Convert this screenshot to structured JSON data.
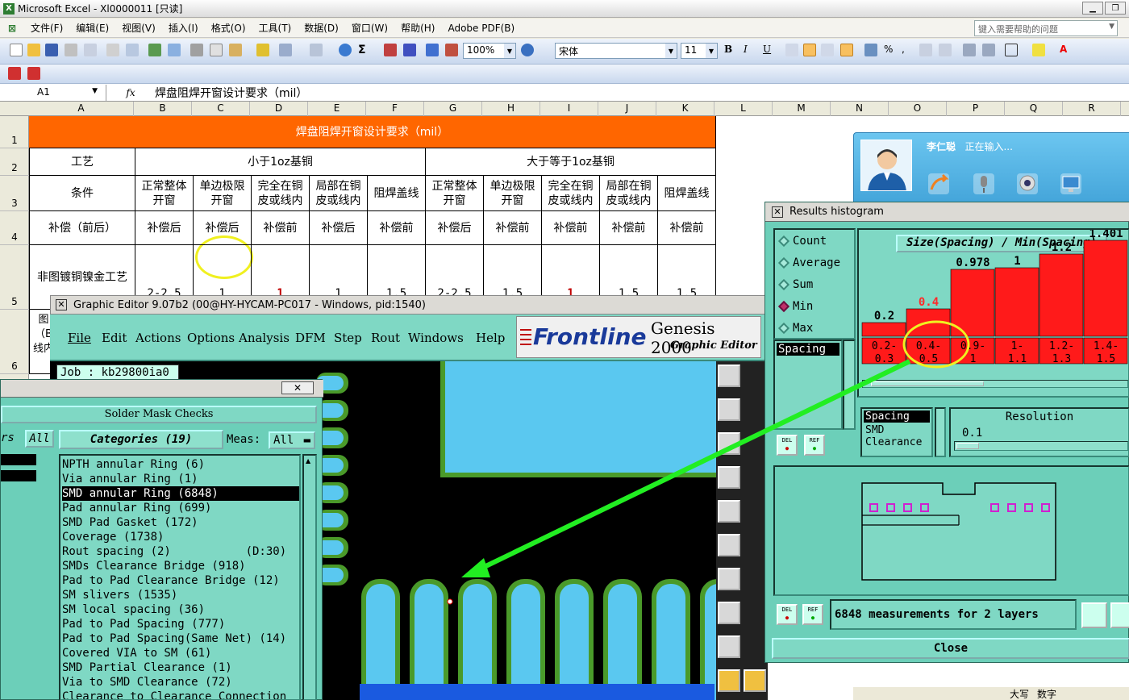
{
  "excel": {
    "title": "Microsoft Excel - Xl0000011  [只读]",
    "menu": [
      "文件(F)",
      "编辑(E)",
      "视图(V)",
      "插入(I)",
      "格式(O)",
      "工具(T)",
      "数据(D)",
      "窗口(W)",
      "帮助(H)",
      "Adobe PDF(B)"
    ],
    "help_placeholder": "键入需要帮助的问题",
    "zoom": "100%",
    "font_name": "宋体",
    "font_size": "11",
    "namebox": "A1",
    "fx": "fx",
    "formula": "焊盘阻焊开窗设计要求（mil）",
    "columns": [
      "A",
      "B",
      "C",
      "D",
      "E",
      "F",
      "G",
      "H",
      "I",
      "J",
      "K",
      "L",
      "M",
      "N",
      "O",
      "P",
      "Q",
      "R"
    ],
    "rows": [
      "1",
      "2",
      "3",
      "4",
      "5",
      "6"
    ],
    "table": {
      "title": "焊盘阻焊开窗设计要求（mil）",
      "row2": {
        "process": "工艺",
        "group1": "小于1oz基铜",
        "group2": "大于等于1oz基铜"
      },
      "row3": {
        "label": "条件",
        "headers": [
          "正常整体\n开窗",
          "单边极限\n开窗",
          "完全在铜\n皮或线内",
          "局部在铜\n皮或线内",
          "阻焊盖线",
          "正常整体\n开窗",
          "单边极限\n开窗",
          "完全在铜\n皮或线内",
          "局部在铜\n皮或线内",
          "阻焊盖线"
        ]
      },
      "row4": {
        "label": "补偿（前后）",
        "values": [
          "补偿后",
          "补偿后",
          "补偿前",
          "补偿后",
          "补偿前",
          "补偿后",
          "补偿前",
          "补偿前",
          "补偿前",
          "补偿前"
        ]
      },
      "row5": {
        "label": "非图镀铜镍金工艺",
        "values": [
          "2-2.5",
          "1",
          "1",
          "1",
          "1.5",
          "2-2.5",
          "1.5",
          "1",
          "1.5",
          "1.5"
        ]
      },
      "row6": {
        "label": "图\n（B\n线内"
      }
    },
    "status": [
      "大写",
      "数字"
    ]
  },
  "qq": {
    "name": "李仁聪",
    "status": "正在输入..."
  },
  "genesis": {
    "title": "Graphic Editor 9.07b2 (00@HY-HYCAM-PC017 - Windows, pid:1540)",
    "menu": [
      "File",
      "Edit",
      "Actions",
      "Options",
      "Analysis",
      "DFM",
      "Step",
      "Rout",
      "Windows",
      "Help"
    ],
    "logo_brand": "Frontline",
    "logo_product": "Genesis 2000",
    "logo_sub": "Graphic Editor",
    "job": "Job : kb29800ia0"
  },
  "solder_mask": {
    "close": "✕",
    "header": "Solder Mask Checks",
    "left_tab_frag": "rs",
    "left_all": "All",
    "categories_label": "Categories (19)",
    "meas_label": "Meas:",
    "meas_value": "All",
    "items": [
      {
        "label": "NPTH annular Ring (6)",
        "selected": false
      },
      {
        "label": "Via annular Ring (1)",
        "selected": false
      },
      {
        "label": "SMD annular Ring (6848)",
        "selected": true
      },
      {
        "label": "Pad annular Ring (699)",
        "selected": false
      },
      {
        "label": "SMD Pad Gasket (172)",
        "selected": false
      },
      {
        "label": "Coverage (1738)",
        "selected": false
      },
      {
        "label": "Rout spacing (2)           (D:30)",
        "selected": false
      },
      {
        "label": "SMDs Clearance Bridge (918)",
        "selected": false
      },
      {
        "label": "Pad to Pad Clearance Bridge (12)",
        "selected": false
      },
      {
        "label": "SM slivers (1535)",
        "selected": false
      },
      {
        "label": "SM local spacing (36)",
        "selected": false
      },
      {
        "label": "Pad to Pad Spacing (777)",
        "selected": false
      },
      {
        "label": "Pad to Pad Spacing(Same Net) (14)",
        "selected": false
      },
      {
        "label": "Covered VIA to SM (61)",
        "selected": false
      },
      {
        "label": "SMD Partial Clearance (1)",
        "selected": false
      },
      {
        "label": "Via to SMD Clearance (72)",
        "selected": false
      },
      {
        "label": "Clearance to Clearance Connection",
        "selected": false
      }
    ]
  },
  "histogram": {
    "title": "Results histogram",
    "modes": [
      {
        "label": "Count",
        "on": false
      },
      {
        "label": "Average",
        "on": false
      },
      {
        "label": "Sum",
        "on": false
      },
      {
        "label": "Min",
        "on": true
      },
      {
        "label": "Max",
        "on": false
      }
    ],
    "plot_title": "Size(Spacing) / Min(Spacing)",
    "size_list": [
      "Spacing"
    ],
    "layers": [
      "Spacing",
      "SMD",
      "Clearance"
    ],
    "resolution_label": "Resolution",
    "resolution_value": "0.1",
    "measurements_text": "6848 measurements for 2 layers",
    "close_label": "Close",
    "btn_del": "DEL",
    "btn_ref": "REF"
  },
  "chart_data": {
    "type": "bar",
    "title": "Size(Spacing) / Min(Spacing)",
    "categories": [
      "0.2-0.3",
      "0.4-0.5",
      "0.9-1",
      "1-1.1",
      "1.2-1.3",
      "1.4-1.5"
    ],
    "category_lines": [
      [
        "0.2-",
        "0.3"
      ],
      [
        "0.4-",
        "0.5"
      ],
      [
        "0.9-",
        "1"
      ],
      [
        "1-",
        "1.1"
      ],
      [
        "1.2-",
        "1.3"
      ],
      [
        "1.4-",
        "1.5"
      ]
    ],
    "values": [
      0.2,
      0.4,
      0.978,
      1,
      1.2,
      1.401
    ],
    "value_labels": [
      "0.2",
      "0.4",
      "0.978",
      "1",
      "1.2",
      "1.401"
    ],
    "highlight_index": 1,
    "ylim": [
      0,
      1.6
    ],
    "bar_color": "#ff1a1a",
    "highlight_label_color": "#ff2a2a"
  },
  "colors": {
    "excel_title_fill": "#ff6600",
    "genesis_bg": "#7fd8c4",
    "pad_blue": "#5ac8f0",
    "pad_green": "#4a9a2a",
    "arrow_green": "#22ee22",
    "circle_yellow": "#f0f020"
  }
}
